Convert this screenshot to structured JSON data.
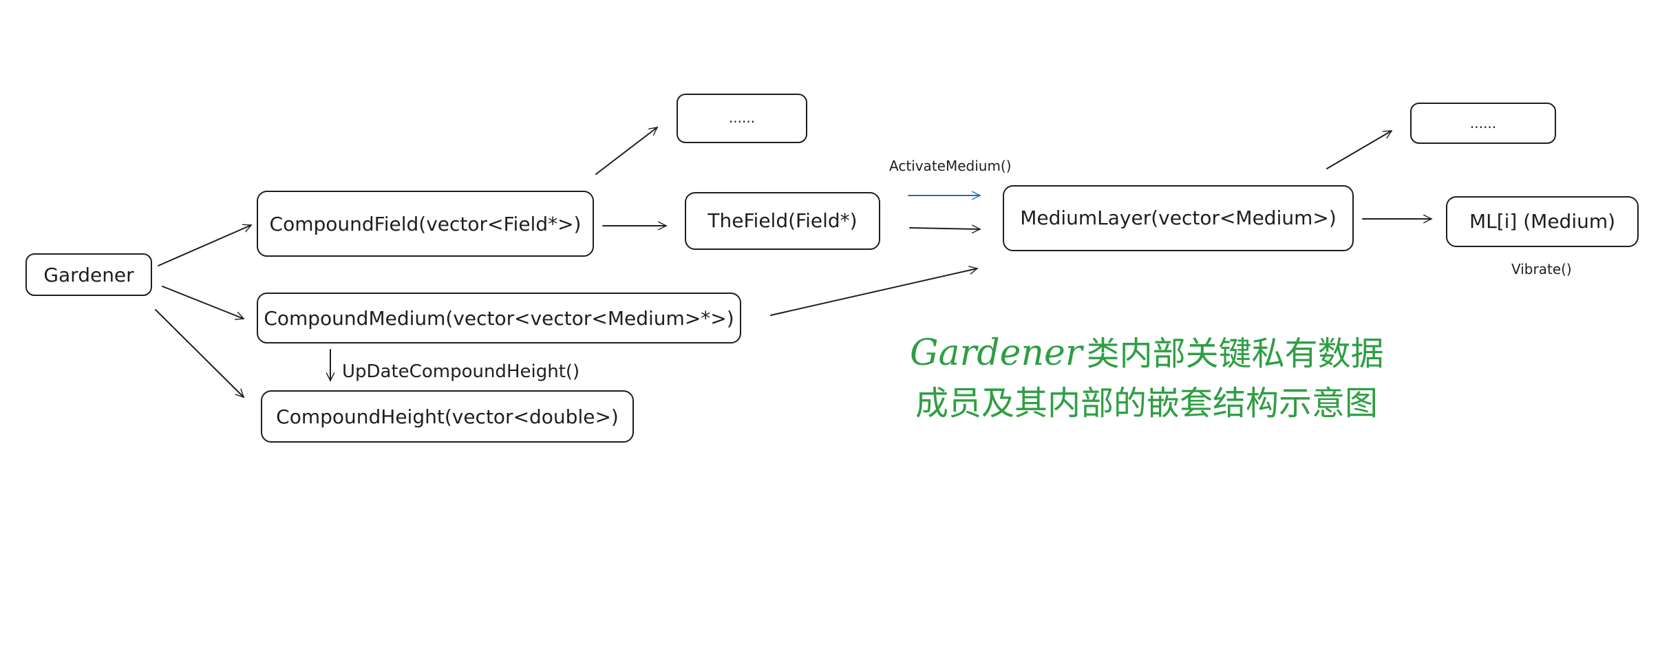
{
  "colors": {
    "ink": "#1e1e1e",
    "accent_blue": "#1971c2",
    "title_green": "#2f9e44"
  },
  "nodes": {
    "gardener": "Gardener",
    "compound_field": "CompoundField(vector<Field*>)",
    "compound_medium": "CompoundMedium(vector<vector<Medium>*>)",
    "compound_height": "CompoundHeight(vector<double>)",
    "ellipsis_top_left": "......",
    "the_field": "TheField(Field*)",
    "medium_layer": "MediumLayer(vector<Medium>)",
    "ellipsis_top_right": "......",
    "ml_i": "ML[i] (Medium)"
  },
  "edge_labels": {
    "update_compound_height": "UpDateCompoundHeight()",
    "activate_medium": "ActivateMedium()",
    "vibrate": "Vibrate()"
  },
  "title": {
    "english": "Gardener",
    "line1_cn": "类内部关键私有数据",
    "line2_cn": "成员及其内部的嵌套结构示意图"
  }
}
